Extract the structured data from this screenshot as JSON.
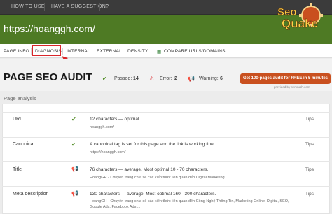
{
  "topbar": {
    "how_to_use": "HOW TO USE",
    "suggestion": "HAVE A SUGGESTION?"
  },
  "header": {
    "url": "https://hoanggh.com/",
    "logo_text_top": "Seo",
    "logo_text_bottom": "Quake"
  },
  "tabs": [
    {
      "label": "PAGE INFO"
    },
    {
      "label": "DIAGNOSIS"
    },
    {
      "label": "INTERNAL"
    },
    {
      "label": "EXTERNAL"
    },
    {
      "label": "DENSITY"
    },
    {
      "label": "COMPARE URLS/DOMAINS"
    }
  ],
  "audit": {
    "title": "PAGE SEO AUDIT",
    "passed_label": "Passed:",
    "passed_count": "14",
    "error_label": "Error:",
    "error_count": "2",
    "warning_label": "Warning:",
    "warning_count": "6",
    "promo": "Get 100-pages audit for FREE in 5 minutes",
    "provided_by": "provided by semrush.com"
  },
  "section_label": "Page analysis",
  "rows": [
    {
      "name": "URL",
      "status": "ok",
      "main": "12 characters — optimal.",
      "sub": "hoanggh.com/",
      "tips": "Tips"
    },
    {
      "name": "Canonical",
      "status": "ok",
      "main": "A canonical tag is set for this page and the link is working fine.",
      "sub": "https://hoanggh.com/",
      "tips": "Tips"
    },
    {
      "name": "Title",
      "status": "warn",
      "main": "76 characters — average. Most optimal 10 - 70 characters.",
      "sub": "HoangGH - Chuyên trang chia sẻ các kiến thức liên quan đến Digital Marketing",
      "tips": "Tips"
    },
    {
      "name": "Meta description",
      "status": "warn",
      "main": "130 characters — average. Most optimal 160 - 300 characters.",
      "sub": "HoangGH - Chuyên trang chia sẻ các kiến thức liên quan đến Công Nghệ Thông Tin, Marketing Online, Digital, SEO, Google Ads, Facebook Ads ...",
      "tips": "Tips"
    }
  ],
  "colors": {
    "header_green": "#4e7a24",
    "ok": "#4e8a22",
    "warn": "#2c7fd1",
    "error": "#d9262a",
    "promo": "#c9501f"
  }
}
